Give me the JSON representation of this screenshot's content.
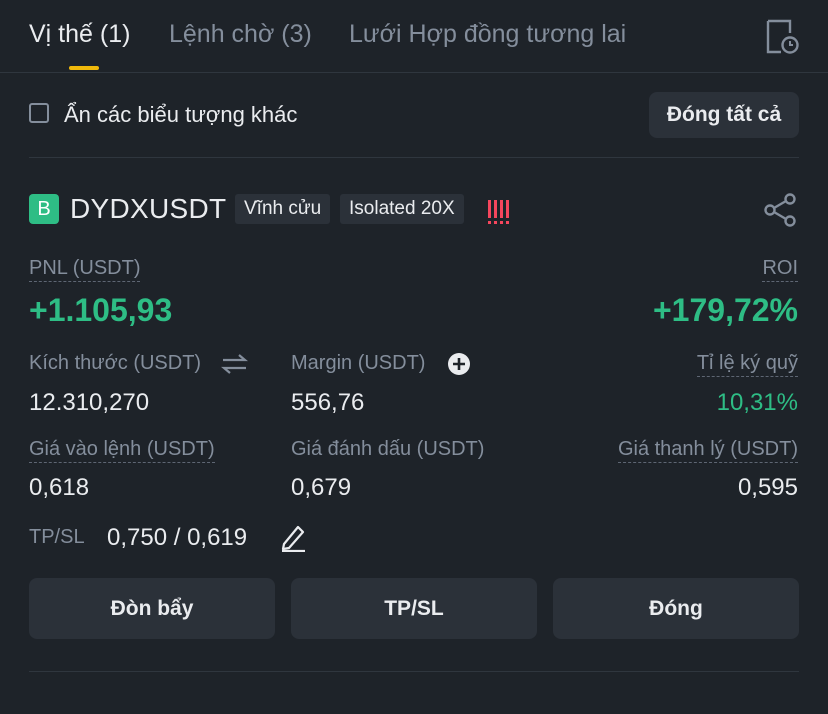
{
  "tabs": [
    {
      "label": "Vị thế (1)",
      "active": true
    },
    {
      "label": "Lệnh chờ (3)",
      "active": false
    },
    {
      "label": "Lưới Hợp đồng tương lai",
      "active": false
    }
  ],
  "filter": {
    "hide_others_label": "Ẩn các biểu tượng khác",
    "hide_others_checked": false,
    "close_all_label": "Đóng tất cả"
  },
  "position": {
    "side_badge": "B",
    "symbol": "DYDXUSDT",
    "contract_type": "Vĩnh cửu",
    "margin_mode": "Isolated 20X",
    "pnl_label": "PNL (USDT)",
    "pnl_value": "+1.105,93",
    "roi_label": "ROI",
    "roi_value": "+179,72%",
    "size_label": "Kích thước (USDT)",
    "size_value": "12.310,270",
    "margin_label": "Margin (USDT)",
    "margin_value": "556,76",
    "margin_ratio_label": "Tỉ lệ ký quỹ",
    "margin_ratio_value": "10,31%",
    "entry_label": "Giá vào lệnh (USDT)",
    "entry_value": "0,618",
    "mark_label": "Giá đánh dấu (USDT)",
    "mark_value": "0,679",
    "liq_label": "Giá thanh lý (USDT)",
    "liq_value": "0,595",
    "tpsl_label": "TP/SL",
    "tpsl_value": "0,750 / 0,619"
  },
  "actions": {
    "leverage": "Đòn bẩy",
    "tpsl": "TP/SL",
    "close": "Đóng"
  },
  "colors": {
    "background": "#1e2329",
    "accent": "#f0b90b",
    "profit": "#2ebd85",
    "risk": "#f6465d",
    "muted": "#848e9c"
  },
  "icons": {
    "history": "history-icon",
    "share": "share-icon",
    "swap": "swap-icon",
    "add": "plus-circle-icon",
    "edit": "pencil-icon"
  }
}
